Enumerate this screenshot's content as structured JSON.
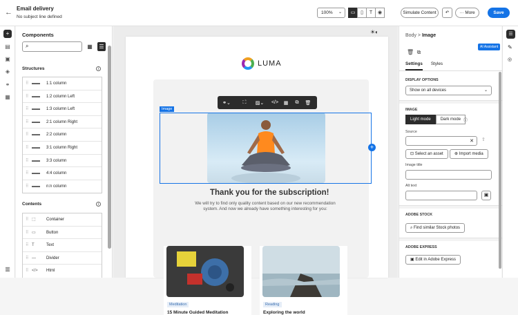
{
  "header": {
    "back": "←",
    "title": "Email delivery",
    "subtitle": "No subject line defined",
    "zoom": "100%",
    "simulate": "Simulate Content",
    "undo": "↶",
    "more": "··· More",
    "save": "Save"
  },
  "components": {
    "title": "Components",
    "structures_label": "Structures",
    "structures": [
      "1:1 column",
      "1:2 column Left",
      "1:3 column Left",
      "2:1 column Right",
      "2:2 column",
      "3:1 column Right",
      "3:3 column",
      "4:4 column",
      "n:n column"
    ],
    "contents_label": "Contents",
    "contents": [
      "Container",
      "Button",
      "Text",
      "Divider",
      "Html"
    ],
    "content_icons": [
      "⬚",
      "▭",
      "T",
      "—",
      "</>"
    ]
  },
  "email": {
    "logo": "LUMA",
    "image_tag": "Image",
    "heading": "Thank you for the subscription!",
    "description": "We will try to find only quality content based on our new recommendation system. And now we already have something interesting for you:",
    "products": [
      {
        "tag": "Meditation",
        "title": "15 Minute Guided Meditation"
      },
      {
        "tag": "Reading",
        "title": "Exploring the world"
      }
    ]
  },
  "panel": {
    "bc_parent": "Body",
    "bc_sep": ">",
    "bc_current": "Image",
    "tab_settings": "Settings",
    "tab_styles": "Styles",
    "display_label": "DISPLAY OPTIONS",
    "display_value": "Show on all devices",
    "image_label": "IMAGE",
    "light": "Light mode",
    "dark": "Dark mode",
    "source_label": "Source",
    "select_asset": "Select an asset",
    "import_media": "Import media",
    "image_title_label": "Image title",
    "alt_label": "Alt text",
    "stock_label": "ADOBE STOCK",
    "stock_btn": "Find similar Stock photos",
    "express_label": "ADOBE EXPRESS",
    "express_btn": "Edit in Adobe Express",
    "ai": "AI Assistant"
  }
}
